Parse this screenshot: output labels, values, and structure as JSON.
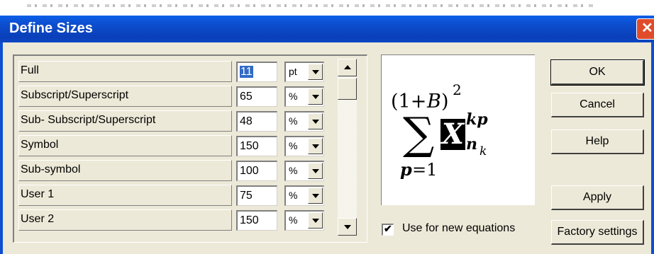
{
  "window": {
    "title": "Define Sizes"
  },
  "sizes": [
    {
      "label": "Full",
      "value": "11",
      "unit": "pt"
    },
    {
      "label": "Subscript/Superscript",
      "value": "65",
      "unit": "%"
    },
    {
      "label": "Sub- Subscript/Superscript",
      "value": "48",
      "unit": "%"
    },
    {
      "label": "Symbol",
      "value": "150",
      "unit": "%"
    },
    {
      "label": "Sub-symbol",
      "value": "100",
      "unit": "%"
    },
    {
      "label": "User 1",
      "value": "75",
      "unit": "%"
    },
    {
      "label": "User 2",
      "value": "150",
      "unit": "%"
    }
  ],
  "preview": {
    "open_paren": "(1+",
    "b": "B",
    "close_paren": ")",
    "exp2": "2",
    "sigma": "∑",
    "x": "X",
    "kp": "kp",
    "n": "n",
    "k": "k",
    "p_eq": "p",
    "eq1": "=1"
  },
  "checkbox": {
    "label": "Use for new equations",
    "checked": true,
    "mark": "✔"
  },
  "buttons": {
    "ok": "OK",
    "cancel": "Cancel",
    "help": "Help",
    "apply": "Apply",
    "factory": "Factory settings"
  },
  "close_glyph": "✕"
}
